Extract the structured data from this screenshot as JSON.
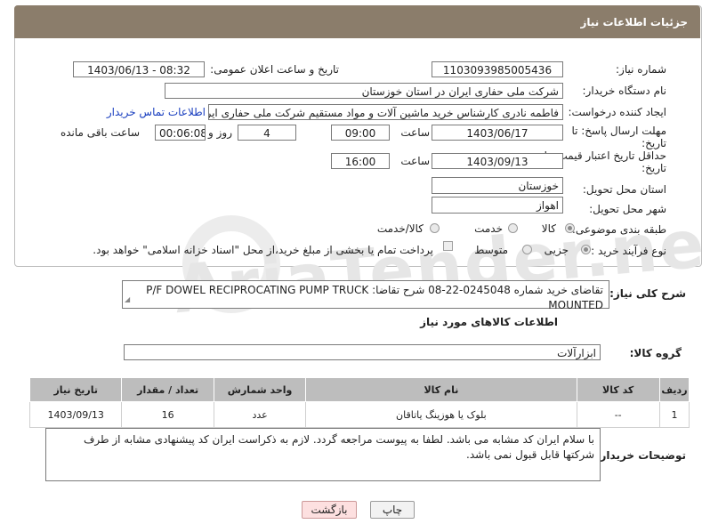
{
  "header": {
    "title": "جزئیات اطلاعات نیاز"
  },
  "fields": {
    "need_number_label": "شماره نیاز:",
    "need_number": "1103093985005436",
    "announce_label": "تاریخ و ساعت اعلان عمومی:",
    "announce_value": "1403/06/13 - 08:32",
    "buyer_label": "نام دستگاه خریدار:",
    "buyer_value": "شرکت ملی حفاری ایران در استان خوزستان",
    "creator_label": "ایجاد کننده درخواست:",
    "creator_value": "فاطمه نادری کارشناس خرید ماشین آلات و مواد مستقیم شرکت ملی حفاری ایر",
    "contact_link": "اطلاعات تماس خریدار",
    "deadline_label_1": "مهلت ارسال پاسخ: تا",
    "deadline_label_2": "تاریخ:",
    "deadline_date": "1403/06/17",
    "time_label": "ساعت",
    "deadline_time": "09:00",
    "days_value": "4",
    "days_label": "روز و",
    "remaining_time": "00:06:08",
    "remaining_label": "ساعت باقی مانده",
    "validity_label_1": "حداقل تاریخ اعتبار قیمت: تا",
    "validity_label_2": "تاریخ:",
    "validity_date": "1403/09/13",
    "validity_time": "16:00",
    "province_label": "استان محل تحویل:",
    "province_value": "خوزستان",
    "city_label": "شهر محل تحویل:",
    "city_value": "اهواز",
    "category_label": "طبقه بندی موضوعی:",
    "category_options": [
      "کالا",
      "خدمت",
      "کالا/خدمت"
    ],
    "process_label": "نوع فرآیند خرید :",
    "process_options": [
      "جزیی",
      "متوسط"
    ],
    "payment_note": "پرداخت تمام یا بخشی از مبلغ خرید،از محل \"اسناد خزانه اسلامی\" خواهد بود."
  },
  "description": {
    "label": "شرح کلی نیاز:",
    "value": "تقاضای خرید شماره 0245048-22-08 شرح تقاضا: P/F DOWEL RECIPROCATING PUMP TRUCK MOUNTED"
  },
  "goods_section": {
    "title": "اطلاعات کالاهای مورد نیاز",
    "group_label": "گروه کالا:",
    "group_value": "ابزارآلات"
  },
  "table": {
    "headers": [
      "ردیف",
      "کد کالا",
      "نام کالا",
      "واحد شمارش",
      "تعداد / مقدار",
      "تاریخ نیاز"
    ],
    "rows": [
      [
        "1",
        "--",
        "بلوک یا هوزینگ یاتاقان",
        "عدد",
        "16",
        "1403/09/13"
      ]
    ]
  },
  "buyer_notes": {
    "label": "توضیحات خریدار:",
    "value": "با سلام ایران کد مشابه می باشد. لطفا به پیوست مراجعه گردد. لازم به ذکراست ایران کد پیشنهادی مشابه از طرف شرکتها قابل قبول نمی باشد."
  },
  "buttons": {
    "print": "چاپ",
    "back": "بازگشت"
  },
  "watermark": "AriaTender.neT"
}
